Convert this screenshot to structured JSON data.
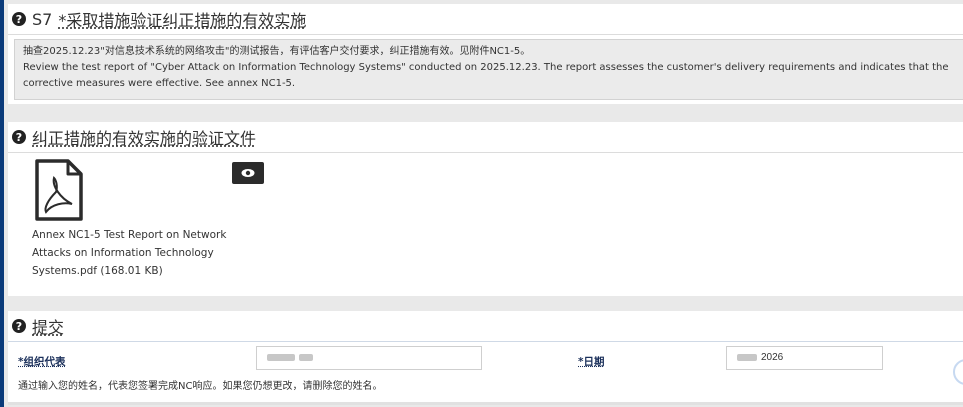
{
  "section_s7": {
    "step": "S7",
    "title": "*采取措施验证纠正措施的有效实施",
    "notes": [
      "抽查2025.12.23\"对信息技术系统的网络攻击\"的测试报告，有评估客户交付要求，纠正措施有效。见附件NC1-5。",
      "Review the test report of \"Cyber Attack on Information Technology Systems\" conducted on 2025.12.23. The report assesses the customer's delivery requirements and indicates that the corrective measures were effective. See annex NC1-5."
    ]
  },
  "evidence": {
    "title": "纠正措施的有效实施的验证文件",
    "file_name": "Annex NC1-5 Test Report on Network Attacks on Information Technology Systems.pdf (168.01 KB)",
    "file_icon": "pdf-file-icon",
    "view_icon": "eye-icon"
  },
  "submit": {
    "title": "提交",
    "rep_label": "*组织代表",
    "date_label": "*日期",
    "date_value": "2026",
    "help": "通过输入您的姓名，代表您签署完成NC响应。如果您仍想更改，请删除您的姓名。"
  },
  "colors": {
    "left_bar": "#0b3b7a",
    "label_blue": "#1a2f5a",
    "notes_bg": "#ebebeb",
    "button_dark": "#2b2b2b"
  }
}
